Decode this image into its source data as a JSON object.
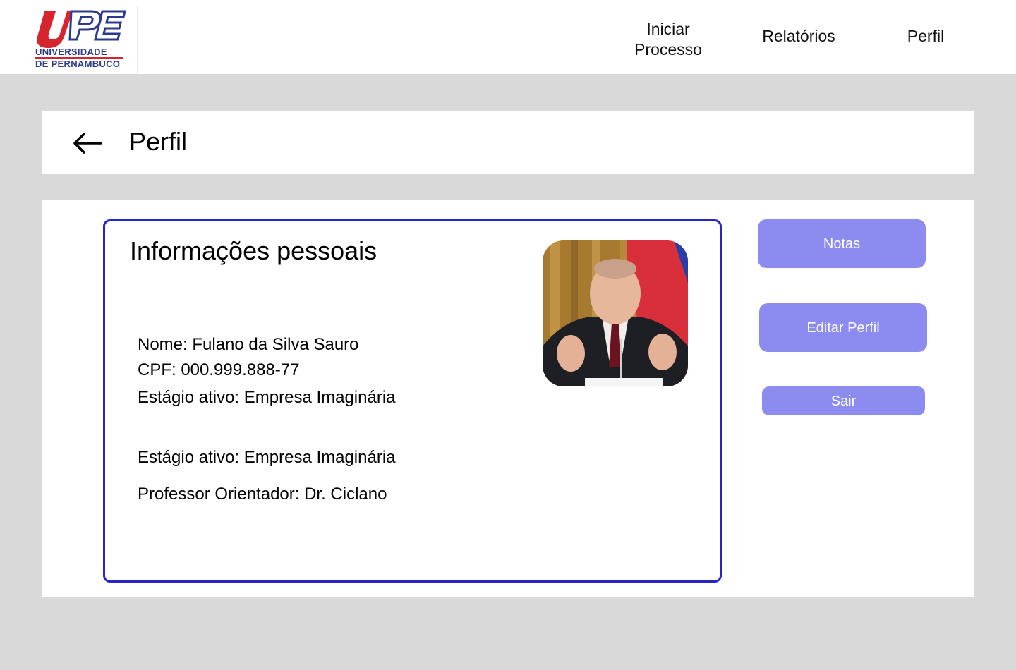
{
  "header": {
    "logo": {
      "mark": "UPE",
      "line1": "UNIVERSIDADE",
      "line2": "DE PERNAMBUCO",
      "colors": {
        "red": "#d6252f",
        "blue": "#2b3a8c"
      }
    },
    "nav": [
      {
        "label_line1": "Iniciar",
        "label_line2": "Processo"
      },
      {
        "label": "Relatórios"
      },
      {
        "label": "Perfil"
      }
    ]
  },
  "title_bar": {
    "back_icon": "arrow-left-icon",
    "title": "Perfil"
  },
  "card": {
    "title": "Informações pessoais",
    "fields": [
      "Nome: Fulano da Silva Sauro",
      "CPF: 000.999.888-77",
      "Estágio ativo: Empresa Imaginária",
      "Estágio ativo: Empresa Imaginária",
      "Professor Orientador: Dr. Ciclano"
    ],
    "photo": "profile-photo"
  },
  "actions": {
    "notas": "Notas",
    "editar": "Editar Perfil",
    "sair": "Sair"
  },
  "colors": {
    "background": "#d9d9d9",
    "panel": "#ffffff",
    "card_border": "#2626c7",
    "button": "#8c8cf0",
    "button_text": "#ffffff"
  }
}
